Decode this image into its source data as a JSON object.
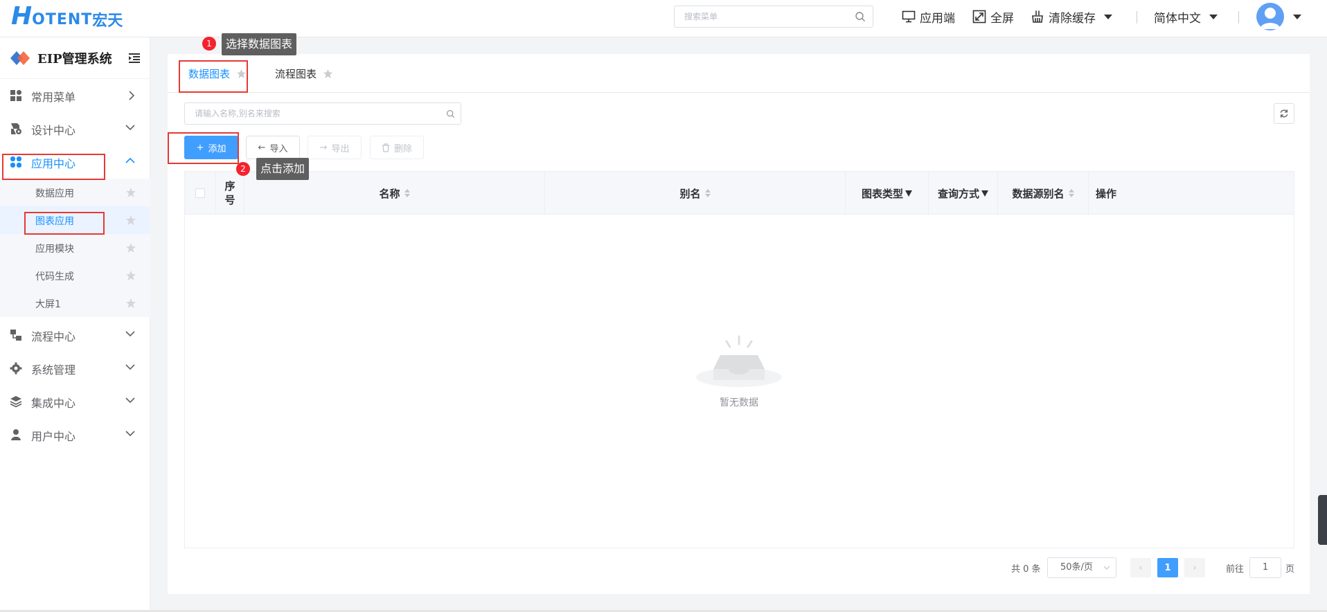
{
  "brand": {
    "logo_h": "H",
    "logo_text": "OTENT",
    "logo_cn": "宏天",
    "system_name": "EIP管理系统"
  },
  "header": {
    "search_placeholder": "搜索菜单",
    "app_client": "应用端",
    "fullscreen": "全屏",
    "clear_cache": "清除缓存",
    "language": "简体中文"
  },
  "sidebar": {
    "menus": [
      {
        "label": "常用菜单",
        "icon": "apps-icon"
      },
      {
        "label": "设计中心",
        "icon": "design-doc-icon"
      },
      {
        "label": "应用中心",
        "icon": "app-center-icon"
      },
      {
        "label": "流程中心",
        "icon": "flow-icon"
      },
      {
        "label": "系统管理",
        "icon": "gear-icon"
      },
      {
        "label": "集成中心",
        "icon": "layers-icon"
      },
      {
        "label": "用户中心",
        "icon": "user-icon"
      }
    ],
    "submenus": [
      {
        "label": "数据应用"
      },
      {
        "label": "图表应用"
      },
      {
        "label": "应用模块"
      },
      {
        "label": "代码生成"
      },
      {
        "label": "大屏1"
      }
    ]
  },
  "tabs": [
    {
      "label": "数据图表"
    },
    {
      "label": "流程图表"
    }
  ],
  "toolbar": {
    "search_placeholder": "请输入名称,别名来搜索",
    "add": "添加",
    "import": "导入",
    "export": "导出",
    "delete": "删除"
  },
  "table": {
    "columns": [
      "序号",
      "名称",
      "别名",
      "图表类型",
      "查询方式",
      "数据源别名",
      "操作"
    ],
    "empty_text": "暂无数据"
  },
  "pagination": {
    "total": "共 0 条",
    "page_size": "50条/页",
    "current_page": "1",
    "goto_label": "前往",
    "goto_value": "1",
    "page_suffix": "页"
  },
  "annotations": {
    "step1_num": "1",
    "step1_text": "选择数据图表",
    "step2_num": "2",
    "step2_text": "点击添加"
  },
  "colors": {
    "accent": "#409eff",
    "highlight": "#e53935",
    "brand": "#2c8ae8"
  }
}
